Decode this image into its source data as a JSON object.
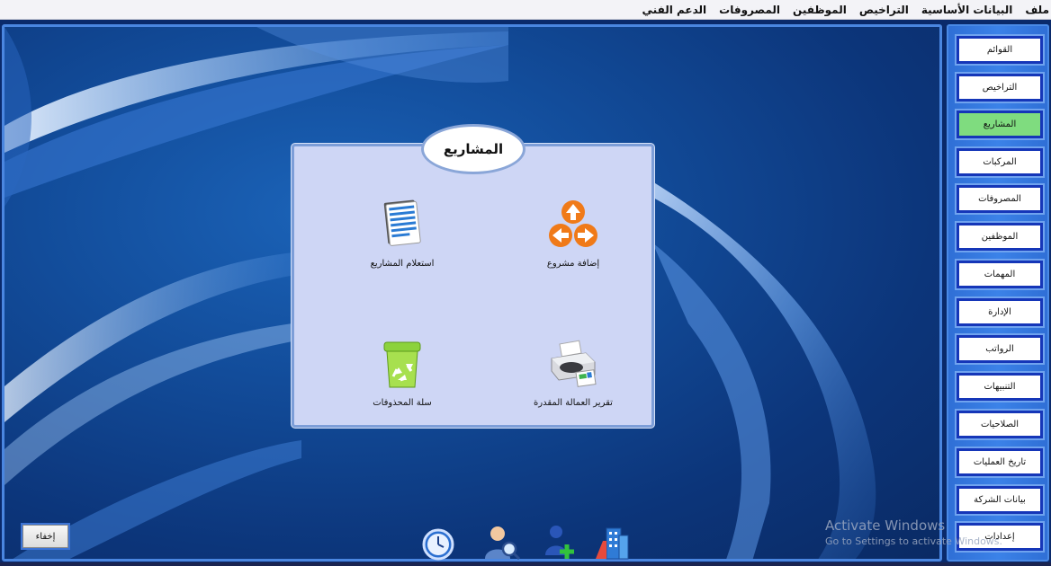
{
  "menu": {
    "items": [
      "ملف",
      "البيانات الأساسية",
      "التراخيص",
      "الموظفين",
      "المصروفات",
      "الدعم الفني"
    ]
  },
  "sidebar": {
    "active_color": "#7fdc7f",
    "items": [
      {
        "label": "القوائم",
        "active": false
      },
      {
        "label": "التراخيص",
        "active": false
      },
      {
        "label": "المشاريع",
        "active": true
      },
      {
        "label": "المركبات",
        "active": false
      },
      {
        "label": "المصروفات",
        "active": false
      },
      {
        "label": "الموظفين",
        "active": false
      },
      {
        "label": "المهمات",
        "active": false
      },
      {
        "label": "الإدارة",
        "active": false
      },
      {
        "label": "الرواتب",
        "active": false
      },
      {
        "label": "التنبيهات",
        "active": false
      },
      {
        "label": "الصلاحيات",
        "active": false
      },
      {
        "label": "تاريخ العمليات",
        "active": false
      },
      {
        "label": "بيانات الشركة",
        "active": false
      },
      {
        "label": "إعدادات",
        "active": false
      }
    ]
  },
  "dialog": {
    "title": "المشاريع",
    "tiles": {
      "add_project": {
        "label": "إضافة مشروع",
        "icon": "arrows-icon"
      },
      "query_projects": {
        "label": "استعلام المشاريع",
        "icon": "notepad-icon"
      },
      "labor_report": {
        "label": "تقرير العمالة المقدرة",
        "icon": "printer-icon"
      },
      "recycle_bin": {
        "label": "سلة المحذوفات",
        "icon": "recycle-bin-icon"
      }
    }
  },
  "hide_button": {
    "label": "إخفاء"
  },
  "dock": {
    "icons": [
      "clock-icon",
      "user-search-icon",
      "add-user-icon",
      "buildings-icon"
    ]
  },
  "watermark": {
    "title": "Activate Windows",
    "subtitle": "Go to Settings to activate Windows."
  }
}
